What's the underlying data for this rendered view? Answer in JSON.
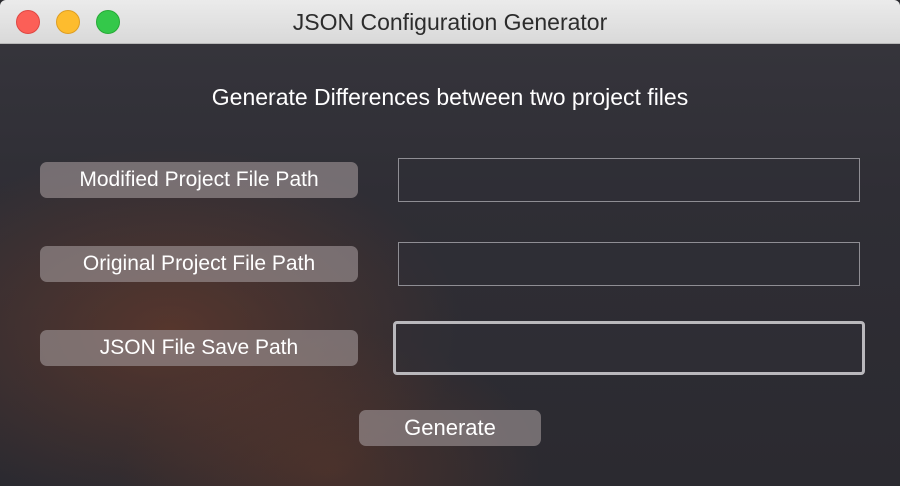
{
  "window": {
    "title": "JSON Configuration Generator"
  },
  "heading": "Generate Differences between two project files",
  "form": {
    "modified_label": "Modified Project File Path",
    "modified_value": "",
    "original_label": "Original Project File Path",
    "original_value": "",
    "save_label": "JSON File Save Path",
    "save_value": ""
  },
  "actions": {
    "generate_label": "Generate"
  },
  "icons": {
    "close": "close-traffic-light",
    "minimize": "minimize-traffic-light",
    "zoom": "zoom-traffic-light"
  },
  "colors": {
    "close": "#fc5f57",
    "minimize": "#fdbc2e",
    "zoom": "#34c84a"
  }
}
